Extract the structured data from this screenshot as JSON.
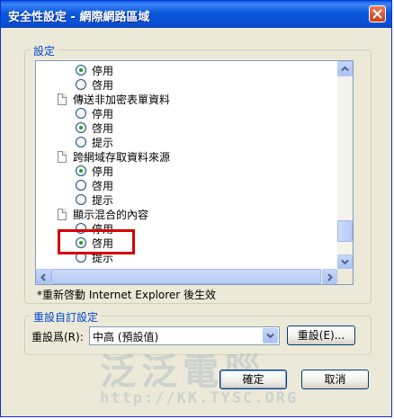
{
  "window": {
    "title": "安全性設定 - 網際網路區域"
  },
  "settings_group": {
    "label": "設定"
  },
  "settings_list": [
    {
      "kind": "radio",
      "label": "停用",
      "checked": true
    },
    {
      "kind": "radio",
      "label": "啓用",
      "checked": false
    },
    {
      "kind": "category",
      "label": "傳送非加密表單資料"
    },
    {
      "kind": "radio",
      "label": "停用",
      "checked": false
    },
    {
      "kind": "radio",
      "label": "啓用",
      "checked": true
    },
    {
      "kind": "radio",
      "label": "提示",
      "checked": false
    },
    {
      "kind": "category",
      "label": "跨網域存取資料來源"
    },
    {
      "kind": "radio",
      "label": "停用",
      "checked": true
    },
    {
      "kind": "radio",
      "label": "啓用",
      "checked": false
    },
    {
      "kind": "radio",
      "label": "提示",
      "checked": false
    },
    {
      "kind": "category",
      "label": "顯示混合的內容"
    },
    {
      "kind": "radio",
      "label": "停用",
      "checked": false
    },
    {
      "kind": "radio",
      "label": "啓用",
      "checked": true
    },
    {
      "kind": "radio",
      "label": "提示",
      "checked": false
    }
  ],
  "scroll": {
    "vertical_position": 0.92
  },
  "restart_note": "*重新啓動 Internet Explorer 後生效",
  "reset_group": {
    "label": "重設自訂設定",
    "reset_to_label": "重設爲(R):",
    "selected_level": "中高 (預設值)",
    "reset_button": "重設(E)..."
  },
  "buttons": {
    "ok": "確定",
    "cancel": "取消"
  },
  "watermark": {
    "main": "泛泛電腦",
    "url": "http://KK.TYSC.ORG"
  },
  "colors": {
    "title_bar": "#0a58dc",
    "highlight_box": "#d40000",
    "group_label": "#0046d5"
  }
}
